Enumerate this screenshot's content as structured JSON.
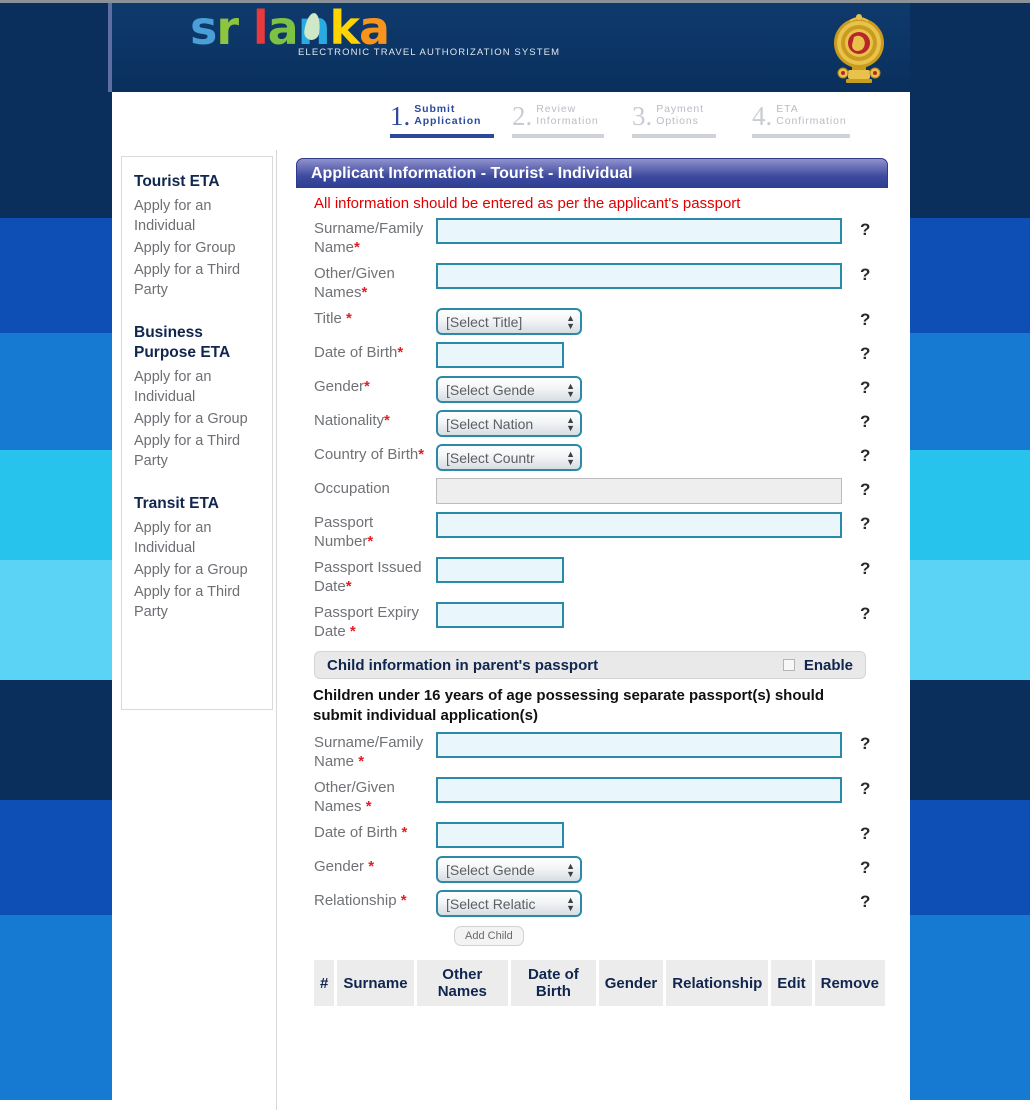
{
  "site": {
    "logo_word": "srilanka",
    "logo_letters": [
      {
        "ch": "s",
        "color": "#4a9fd8"
      },
      {
        "ch": "r",
        "color": "#8cc63f"
      },
      {
        "ch": "i",
        "color": "#e8393c"
      },
      {
        "ch": "l",
        "color": "#e8393c"
      },
      {
        "ch": "a",
        "color": "#7dc242"
      },
      {
        "ch": "n",
        "color": "#29abe2"
      },
      {
        "ch": "k",
        "color": "#ffd400"
      },
      {
        "ch": "a",
        "color": "#f7941e"
      }
    ],
    "tagline": "ELECTRONIC TRAVEL AUTHORIZATION SYSTEM",
    "emblem_name": "sri-lanka-national-emblem"
  },
  "steps": [
    {
      "num": "1",
      "line1": "Submit",
      "line2": "Application",
      "state": "active"
    },
    {
      "num": "2",
      "line1": "Review",
      "line2": "Information",
      "state": "inactive"
    },
    {
      "num": "3",
      "line1": "Payment",
      "line2": "Options",
      "state": "inactive"
    },
    {
      "num": "4",
      "line1": "ETA",
      "line2": "Confirmation",
      "state": "inactive"
    }
  ],
  "sidebar": {
    "groups": [
      {
        "heading": "Tourist ETA",
        "links": [
          "Apply for an Individual",
          "Apply for Group",
          "Apply for a Third Party"
        ]
      },
      {
        "heading": "Business Purpose ETA",
        "links": [
          "Apply for an Individual",
          "Apply for a Group",
          "Apply for a Third Party"
        ]
      },
      {
        "heading": "Transit ETA",
        "links": [
          "Apply for an Individual",
          "Apply for a Group",
          "Apply for a Third Party"
        ]
      }
    ]
  },
  "form": {
    "title": "Applicant Information - Tourist - Individual",
    "note": "All information should be entered as per the applicant's passport",
    "help_glyph": "?",
    "fields": {
      "surname": {
        "label": "Surname/Family Name",
        "required": "*",
        "value": ""
      },
      "given": {
        "label": "Other/Given Names",
        "required": "*",
        "value": ""
      },
      "title": {
        "label": "Title ",
        "required": "*",
        "value": "[Select Title]"
      },
      "dob": {
        "label": "Date of Birth",
        "required": "*",
        "value": ""
      },
      "gender": {
        "label": "Gender",
        "required": "*",
        "value": "[Select Gende"
      },
      "nationality": {
        "label": "Nationality",
        "required": "*",
        "value": "[Select Nation"
      },
      "country_of_birth": {
        "label": "Country of Birth",
        "required": "*",
        "value": "[Select Countr"
      },
      "occupation": {
        "label": "Occupation",
        "required": "",
        "value": ""
      },
      "passport_number": {
        "label": "Passport Number",
        "required": "*",
        "value": ""
      },
      "passport_issued": {
        "label": "Passport Issued Date",
        "required": "*",
        "value": ""
      },
      "passport_expiry": {
        "label": "Passport Expiry Date ",
        "required": "*",
        "value": ""
      }
    }
  },
  "child": {
    "band_title": "Child information in parent's passport",
    "enable_label": "Enable",
    "enabled": false,
    "warning": "Children under 16 years of age possessing separate passport(s) should submit individual application(s)",
    "fields": {
      "surname": {
        "label": "Surname/Family Name ",
        "required": "*",
        "value": ""
      },
      "given": {
        "label": "Other/Given Names ",
        "required": "*",
        "value": ""
      },
      "dob": {
        "label": "Date of Birth ",
        "required": "*",
        "value": ""
      },
      "gender": {
        "label": "Gender ",
        "required": "*",
        "value": "[Select Gende"
      },
      "relationship": {
        "label": "Relationship ",
        "required": "*",
        "value": "[Select Relatic"
      }
    },
    "add_button": "Add Child",
    "table": {
      "headers": [
        "#",
        "Surname",
        "Other Names",
        "Date of Birth",
        "Gender",
        "Relationship",
        "Edit",
        "Remove"
      ],
      "rows": []
    }
  },
  "theme": {
    "header_blue": "#0c3565",
    "accent_field_border": "#2a8aa8",
    "field_fill": "#e9f7fd",
    "required_red": "#e51b24",
    "note_red": "#e00000",
    "title_navy": "#10264e",
    "active_step": "#2b4a9e",
    "bands": [
      "#0a2f5c",
      "#0e4fb5",
      "#1679d2",
      "#27c3ec",
      "#5ad3f5"
    ]
  }
}
